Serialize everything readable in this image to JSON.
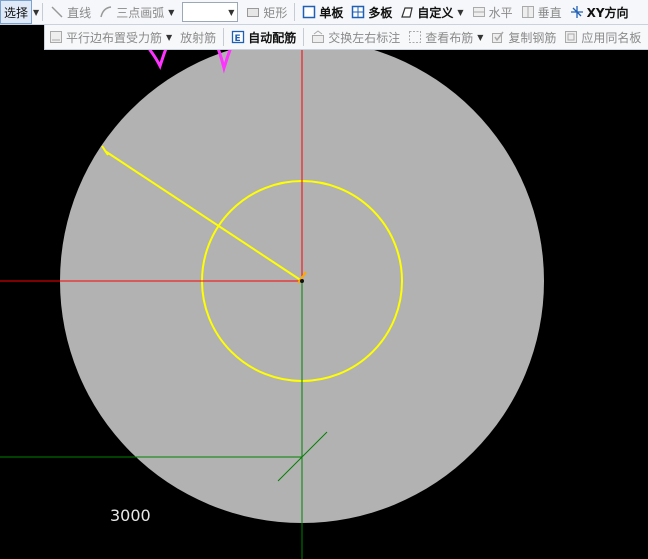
{
  "toolbar": {
    "select_label": "选择",
    "line_label": "直线",
    "arc_label": "三点画弧",
    "rect_label": "矩形",
    "single_slab_label": "单板",
    "multi_slab_label": "多板",
    "custom_label": "自定义",
    "horizontal_label": "水平",
    "vertical_label": "垂直",
    "xy_label": "XY方向"
  },
  "toolbar2": {
    "parallel_label": "平行边布置受力筋",
    "radial_label": "放射筋",
    "auto_label": "自动配筋",
    "swap_label": "交换左右标注",
    "view_label": "查看布筋",
    "copy_label": "复制钢筋",
    "apply_label": "应用同名板"
  },
  "canvas": {
    "dimension_label": "3000",
    "colors": {
      "background": "#000000",
      "slab": "#b2b2b2",
      "rebar": "#ffff00",
      "x_axis": "#ff0000",
      "y_axis": "#008000",
      "annotation": "#ff33ff"
    }
  }
}
